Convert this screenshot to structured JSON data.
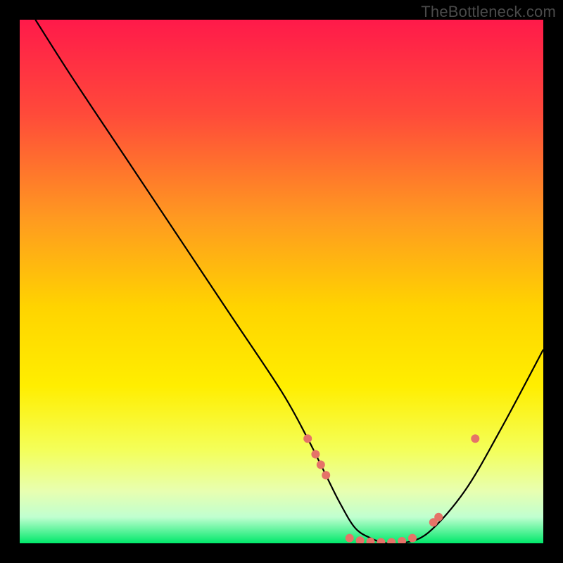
{
  "watermark": "TheBottleneck.com",
  "chart_data": {
    "type": "line",
    "title": "",
    "xlabel": "",
    "ylabel": "",
    "xlim": [
      0,
      100
    ],
    "ylim": [
      0,
      100
    ],
    "grid": false,
    "background_gradient": [
      "#ff1a4a",
      "#ff6038",
      "#ffb020",
      "#ffe000",
      "#f8ff40",
      "#e8ffb0",
      "#00e86a"
    ],
    "series": [
      {
        "name": "bottleneck-curve",
        "color": "#000000",
        "x": [
          3,
          10,
          20,
          30,
          40,
          50,
          55,
          58,
          61,
          64,
          67,
          70,
          73,
          78,
          85,
          92,
          100
        ],
        "y": [
          100,
          89,
          74,
          59,
          44,
          29,
          20,
          14,
          8,
          3,
          1,
          0,
          0,
          2,
          10,
          22,
          37
        ]
      }
    ],
    "markers": {
      "name": "highlight-dots",
      "color": "#e57368",
      "points": [
        {
          "x": 55,
          "y": 20
        },
        {
          "x": 56.5,
          "y": 17
        },
        {
          "x": 57.5,
          "y": 15
        },
        {
          "x": 58.5,
          "y": 13
        },
        {
          "x": 63,
          "y": 1
        },
        {
          "x": 65,
          "y": 0.5
        },
        {
          "x": 67,
          "y": 0.3
        },
        {
          "x": 69,
          "y": 0.2
        },
        {
          "x": 71,
          "y": 0.2
        },
        {
          "x": 73,
          "y": 0.4
        },
        {
          "x": 75,
          "y": 1
        },
        {
          "x": 79,
          "y": 4
        },
        {
          "x": 80,
          "y": 5
        },
        {
          "x": 87,
          "y": 20
        }
      ]
    }
  }
}
